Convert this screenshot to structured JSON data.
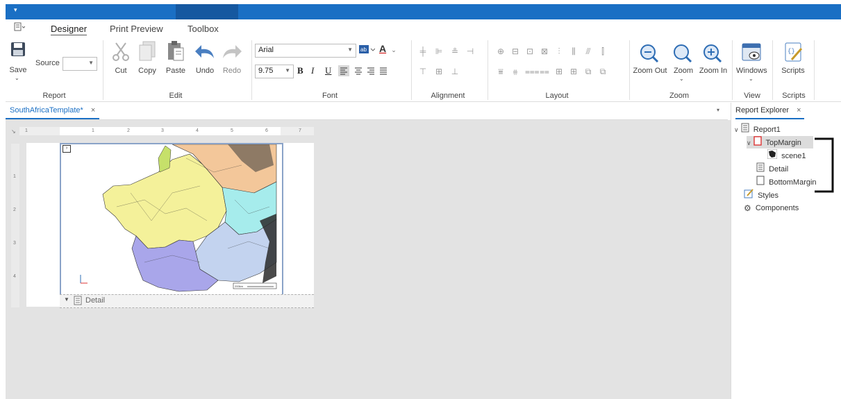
{
  "title_bar": {
    "quick_access_icon": "dropdown-arrow-icon"
  },
  "menu": {
    "app_menu_icon": "app-menu-icon",
    "tabs": [
      "Designer",
      "Print Preview",
      "Toolbox"
    ]
  },
  "ribbon": {
    "report": {
      "save_label": "Save",
      "source_label": "Source",
      "source_value": "",
      "group_label": "Report"
    },
    "edit": {
      "cut": "Cut",
      "copy": "Copy",
      "paste": "Paste",
      "undo": "Undo",
      "redo": "Redo",
      "group_label": "Edit"
    },
    "font": {
      "font_family": "Arial",
      "font_size": "9.75",
      "bold": "B",
      "italic": "I",
      "underline": "U",
      "font_color_glyph": "A",
      "group_label": "Font"
    },
    "alignment": {
      "group_label": "Alignment"
    },
    "layout": {
      "group_label": "Layout"
    },
    "zoom": {
      "zoom_out": "Zoom Out",
      "zoom": "Zoom",
      "zoom_in": "Zoom In",
      "group_label": "Zoom"
    },
    "view": {
      "windows": "Windows",
      "group_label": "View"
    },
    "scripts": {
      "scripts": "Scripts",
      "group_label": "Scripts"
    }
  },
  "document": {
    "tab_label": "SouthAfricaTemplate*",
    "ruler_h": [
      "1",
      "1",
      "2",
      "3",
      "4",
      "5",
      "6",
      "7"
    ],
    "ruler_v": [
      "1",
      "2",
      "3",
      "4"
    ],
    "band_detail_label": "Detail",
    "map_scale_label": "200km"
  },
  "explorer": {
    "title": "Report Explorer",
    "nodes": {
      "report": "Report1",
      "top_margin": "TopMargin",
      "scene": "scene1",
      "detail": "Detail",
      "bottom_margin": "BottomMargin",
      "styles": "Styles",
      "components": "Components"
    }
  },
  "colors": {
    "accent": "#1a6fc4",
    "selection": "#dcdcdc",
    "band_border": "#8aa3c8"
  }
}
